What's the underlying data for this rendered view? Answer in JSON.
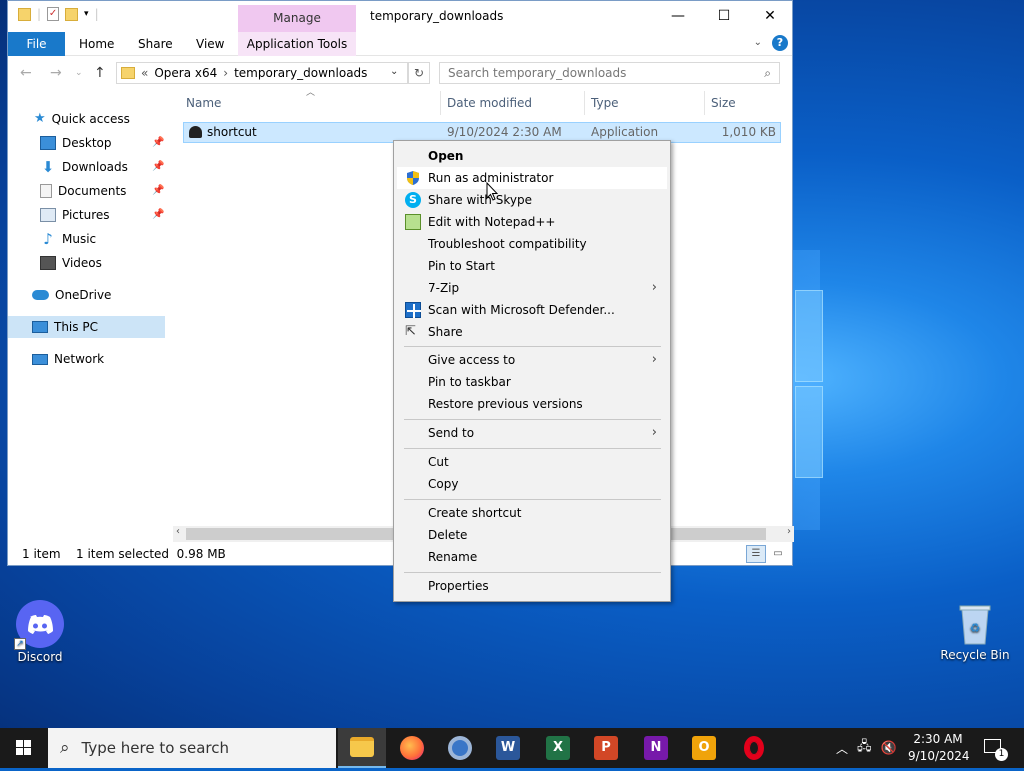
{
  "window": {
    "title": "temporary_downloads",
    "context_tab": "Manage",
    "context_subtab": "Application Tools",
    "ribbon_tabs": [
      "File",
      "Home",
      "Share",
      "View"
    ],
    "controls": {
      "minimize": "—",
      "maximize": "☐",
      "close": "✕"
    }
  },
  "address": {
    "prefix": "«",
    "path": [
      "Opera x64",
      "temporary_downloads"
    ],
    "separator": "›",
    "search_placeholder": "Search temporary_downloads"
  },
  "nav": {
    "quick_access": "Quick access",
    "items": [
      {
        "label": "Desktop",
        "pinned": true,
        "icon": "desktop-icon"
      },
      {
        "label": "Downloads",
        "pinned": true,
        "icon": "downloads-icon"
      },
      {
        "label": "Documents",
        "pinned": true,
        "icon": "documents-icon"
      },
      {
        "label": "Pictures",
        "pinned": true,
        "icon": "pictures-icon"
      },
      {
        "label": "Music",
        "pinned": false,
        "icon": "music-icon"
      },
      {
        "label": "Videos",
        "pinned": false,
        "icon": "videos-icon"
      }
    ],
    "onedrive": "OneDrive",
    "this_pc": "This PC",
    "network": "Network"
  },
  "columns": [
    "Name",
    "Date modified",
    "Type",
    "Size"
  ],
  "files": [
    {
      "name": "shortcut",
      "date": "9/10/2024 2:30 AM",
      "type": "Application",
      "size": "1,010 KB"
    }
  ],
  "status": {
    "count": "1 item",
    "selected": "1 item selected  0.98 MB"
  },
  "context_menu": {
    "group1": [
      {
        "label": "Open",
        "bold": true
      },
      {
        "label": "Run as administrator",
        "icon": "shield-icon",
        "highlight": true
      },
      {
        "label": "Share with Skype",
        "icon": "skype-icon"
      },
      {
        "label": "Edit with Notepad++",
        "icon": "notepadpp-icon"
      },
      {
        "label": "Troubleshoot compatibility"
      },
      {
        "label": "Pin to Start"
      },
      {
        "label": "7-Zip",
        "submenu": true
      },
      {
        "label": "Scan with Microsoft Defender...",
        "icon": "defender-icon"
      },
      {
        "label": "Share",
        "icon": "share-icon"
      }
    ],
    "group2": [
      {
        "label": "Give access to",
        "submenu": true
      },
      {
        "label": "Pin to taskbar"
      },
      {
        "label": "Restore previous versions"
      }
    ],
    "group3": [
      {
        "label": "Send to",
        "submenu": true
      }
    ],
    "group4": [
      {
        "label": "Cut"
      },
      {
        "label": "Copy"
      }
    ],
    "group5": [
      {
        "label": "Create shortcut"
      },
      {
        "label": "Delete"
      },
      {
        "label": "Rename"
      }
    ],
    "group6": [
      {
        "label": "Properties"
      }
    ]
  },
  "desktop": {
    "icons": [
      {
        "label": "Discord"
      },
      {
        "label": "Recycle Bin"
      }
    ]
  },
  "taskbar": {
    "search_placeholder": "Type here to search",
    "time": "2:30 AM",
    "date": "9/10/2024",
    "notif_count": "1",
    "apps": [
      "File Explorer",
      "Firefox",
      "Chrome",
      "Word",
      "Excel",
      "PowerPoint",
      "OneNote",
      "Outlook",
      "Opera"
    ]
  },
  "colors": {
    "accent": "#1979ca",
    "selection": "#cce8ff",
    "manage_tab": "#f0c8f0",
    "taskbar": "#1a1a1a"
  }
}
